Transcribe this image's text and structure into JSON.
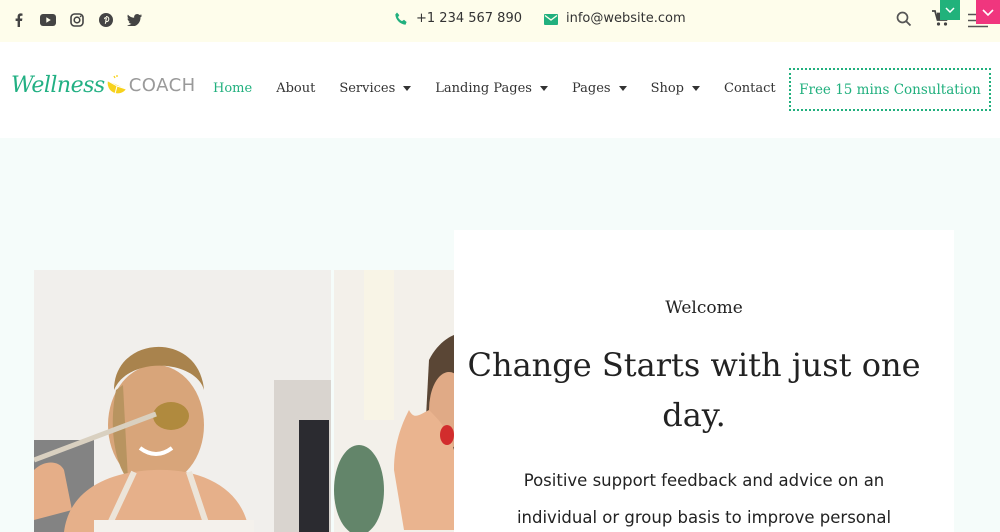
{
  "topbar": {
    "social_icons": [
      "facebook-icon",
      "youtube-icon",
      "instagram-icon",
      "pinterest-icon",
      "twitter-icon"
    ],
    "phone": "+1 234 567 890",
    "email": "info@website.com",
    "tool_icons": [
      "search-icon",
      "cart-icon",
      "menu-icon"
    ]
  },
  "header": {
    "logo": {
      "script": "Wellness",
      "word": "COACH"
    },
    "nav": [
      {
        "label": "Home",
        "active": true,
        "dropdown": false
      },
      {
        "label": "About",
        "active": false,
        "dropdown": false
      },
      {
        "label": "Services",
        "active": false,
        "dropdown": true
      },
      {
        "label": "Landing Pages",
        "active": false,
        "dropdown": true
      },
      {
        "label": "Pages",
        "active": false,
        "dropdown": true
      },
      {
        "label": "Shop",
        "active": false,
        "dropdown": true
      },
      {
        "label": "Contact",
        "active": false,
        "dropdown": false
      }
    ],
    "cta_label": "Free 15 mins Consultation"
  },
  "hero": {
    "eyebrow": "Welcome",
    "headline": "Change Starts with just one day.",
    "paragraph": "Positive support feedback and advice on an individual or group basis to improve personal"
  },
  "colors": {
    "accent": "#21b07e",
    "pink": "#f0367e",
    "topbar_bg": "#fefdeb",
    "hero_bg": "#f5fcfa",
    "lemon": "#f7d21c"
  }
}
